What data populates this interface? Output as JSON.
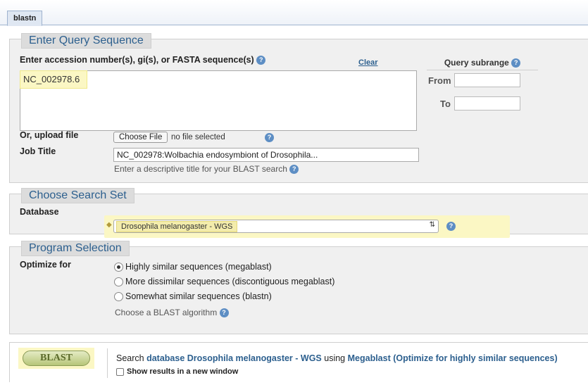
{
  "tab": {
    "label": "blastn"
  },
  "query": {
    "legend": "Enter Query Sequence",
    "label": "Enter accession number(s), gi(s), or FASTA sequence(s)",
    "clear_label": "Clear",
    "sequence_value": "NC_002978.6",
    "subrange_title": "Query subrange",
    "from_label": "From",
    "to_label": "To",
    "from_value": "",
    "to_value": "",
    "upload_label": "Or, upload file",
    "choose_file_label": "Choose File",
    "no_file_text": "no file selected",
    "job_title_label": "Job Title",
    "job_title_value": "NC_002978:Wolbachia endosymbiont of Drosophila...",
    "job_title_hint": "Enter a descriptive title for your BLAST search"
  },
  "search_set": {
    "legend": "Choose Search Set",
    "database_label": "Database",
    "database_value": "Drosophila melanogaster - WGS"
  },
  "program": {
    "legend": "Program Selection",
    "optimize_label": "Optimize for",
    "options": [
      {
        "label": "Highly similar sequences (megablast)",
        "selected": true
      },
      {
        "label": "More dissimilar sequences (discontiguous megablast)",
        "selected": false
      },
      {
        "label": "Somewhat similar sequences (blastn)",
        "selected": false
      }
    ],
    "hint": "Choose a BLAST algorithm"
  },
  "submit": {
    "button_label": "BLAST",
    "search_word": "Search",
    "database_phrase": "database Drosophila melanogaster - WGS",
    "using_word": "using",
    "program_phrase": "Megablast (Optimize for highly similar sequences)",
    "new_window_label": "Show results in a new window"
  },
  "colors": {
    "highlight": "#fbf7c4",
    "legend_text": "#2c5f8e",
    "link": "#2c5f8e"
  }
}
